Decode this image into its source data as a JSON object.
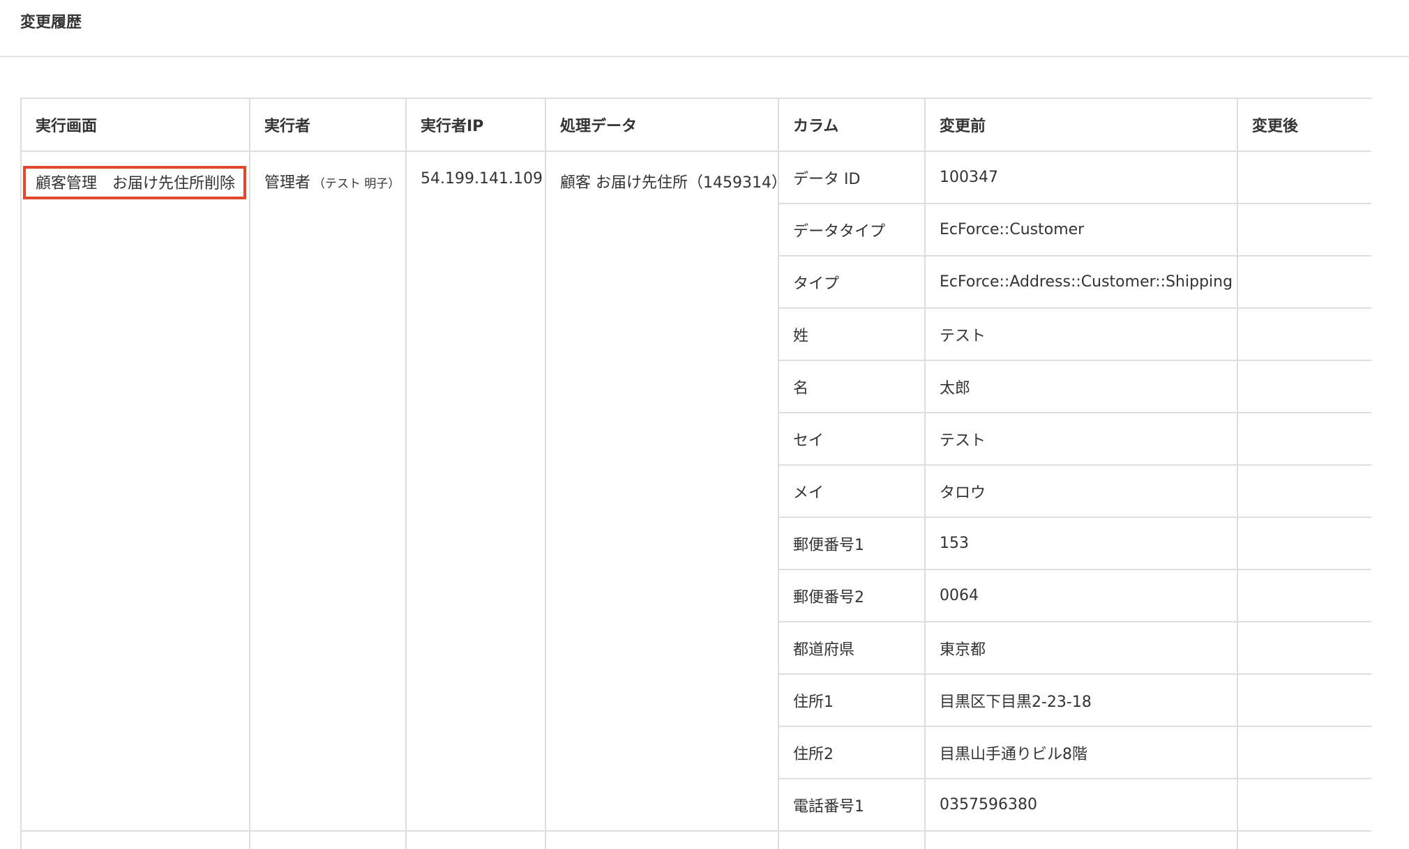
{
  "page": {
    "title": "変更履歴"
  },
  "table": {
    "headers": {
      "screen": "実行画面",
      "executor": "実行者",
      "executor_ip": "実行者IP",
      "target": "処理データ",
      "column": "カラム",
      "before": "変更前",
      "after": "変更後"
    },
    "record": {
      "screen": "顧客管理　お届け先住所削除",
      "executor": "管理者",
      "executor_detail": "（テスト 明子）",
      "executor_ip": "54.199.141.109",
      "target": "顧客 お届け先住所（1459314）"
    },
    "rows": [
      {
        "column": "データ ID",
        "before": "100347",
        "after": ""
      },
      {
        "column": "データタイプ",
        "before": "EcForce::Customer",
        "after": ""
      },
      {
        "column": "タイプ",
        "before": "EcForce::Address::Customer::Shipping",
        "after": ""
      },
      {
        "column": "姓",
        "before": "テスト",
        "after": ""
      },
      {
        "column": "名",
        "before": "太郎",
        "after": ""
      },
      {
        "column": "セイ",
        "before": "テスト",
        "after": ""
      },
      {
        "column": "メイ",
        "before": "タロウ",
        "after": ""
      },
      {
        "column": "郵便番号1",
        "before": "153",
        "after": ""
      },
      {
        "column": "郵便番号2",
        "before": "0064",
        "after": ""
      },
      {
        "column": "都道府県",
        "before": "東京都",
        "after": ""
      },
      {
        "column": "住所1",
        "before": "目黒区下目黒2-23-18",
        "after": ""
      },
      {
        "column": "住所2",
        "before": "目黒山手通りビル8階",
        "after": ""
      },
      {
        "column": "電話番号1",
        "before": "0357596380",
        "after": ""
      }
    ]
  },
  "highlight_color": "#e0492e"
}
